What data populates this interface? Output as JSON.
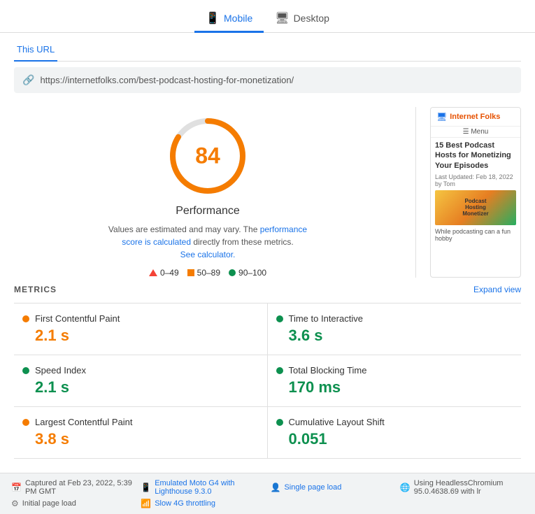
{
  "tabs": [
    {
      "id": "mobile",
      "label": "Mobile",
      "icon": "📱",
      "active": true
    },
    {
      "id": "desktop",
      "label": "Desktop",
      "icon": "🖥",
      "active": false
    }
  ],
  "url_tab": {
    "label": "This URL"
  },
  "url": "https://internetfolks.com/best-podcast-hosting-for-monetization/",
  "performance": {
    "score": 84,
    "title": "Performance",
    "description_prefix": "Values are estimated and may vary. The ",
    "description_link": "performance score is calculated",
    "description_suffix": " directly from these metrics.",
    "see_calculator": "See calculator.",
    "legend": [
      {
        "type": "triangle",
        "range": "0–49"
      },
      {
        "type": "square",
        "range": "50–89"
      },
      {
        "type": "dot",
        "color": "#0d904f",
        "range": "90–100"
      }
    ]
  },
  "preview": {
    "header_icon": "🖥",
    "header_text": "Internet Folks",
    "menu": "☰ Menu",
    "title": "15 Best Podcast Hosts for Monetizing Your Episodes",
    "date": "Last Updated: Feb 18, 2022 by Tom",
    "image_text": "Podcast\nHosting\nMonetizer",
    "footer": "While podcasting can a fun hobby"
  },
  "metrics": {
    "section_title": "METRICS",
    "expand_label": "Expand view",
    "items": [
      {
        "name": "First Contentful Paint",
        "value": "2.1 s",
        "color": "#f57c00",
        "color_class": "orange",
        "dot_color": "#f57c00"
      },
      {
        "name": "Time to Interactive",
        "value": "3.6 s",
        "color": "#0d904f",
        "color_class": "green",
        "dot_color": "#0d904f"
      },
      {
        "name": "Speed Index",
        "value": "2.1 s",
        "color": "#0d904f",
        "color_class": "green",
        "dot_color": "#0d904f"
      },
      {
        "name": "Total Blocking Time",
        "value": "170 ms",
        "color": "#0d904f",
        "color_class": "green",
        "dot_color": "#0d904f"
      },
      {
        "name": "Largest Contentful Paint",
        "value": "3.8 s",
        "color": "#f57c00",
        "color_class": "orange",
        "dot_color": "#f57c00"
      },
      {
        "name": "Cumulative Layout Shift",
        "value": "0.051",
        "color": "#0d904f",
        "color_class": "green",
        "dot_color": "#0d904f"
      }
    ]
  },
  "footer": {
    "items": [
      {
        "icon": "📅",
        "text": "Captured at Feb 23, 2022, 5:39 PM GMT"
      },
      {
        "icon": "📱",
        "text": "Emulated Moto G4 with Lighthouse 9.3.0",
        "linkable": true
      },
      {
        "icon": "👤",
        "text": "Single page load",
        "linkable": true
      },
      {
        "icon": "🌐",
        "text": "Using HeadlessChromium 95.0.4638.69 with lr"
      },
      {
        "icon": "⚙",
        "text": "Initial page load"
      },
      {
        "icon": "📶",
        "text": "Slow 4G throttling",
        "linkable": true
      }
    ]
  }
}
